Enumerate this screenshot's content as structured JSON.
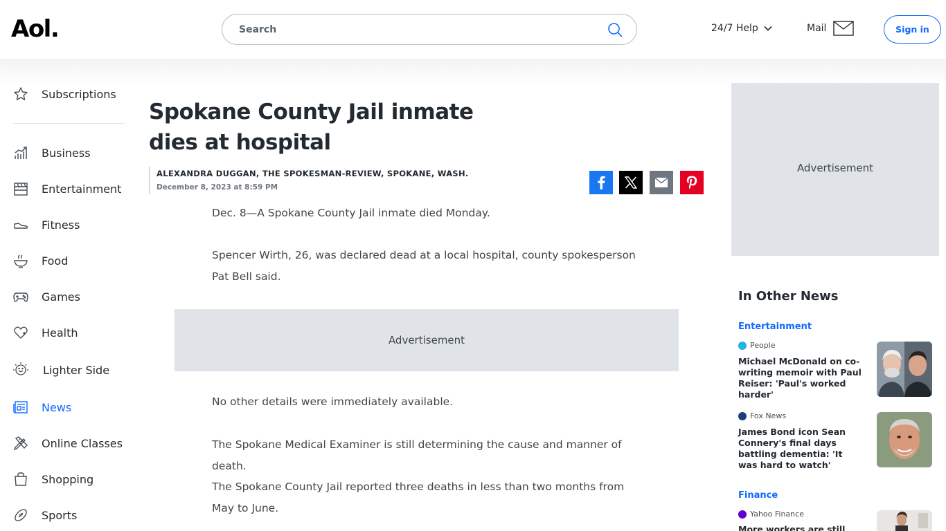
{
  "header": {
    "logo": "Aol.",
    "search_placeholder": "Search",
    "help_label": "24/7 Help",
    "mail_label": "Mail",
    "signin_label": "Sign in"
  },
  "sidebar": {
    "items": [
      {
        "label": "Subscriptions",
        "icon": "star-icon"
      },
      {
        "label": "Business",
        "icon": "chart-icon"
      },
      {
        "label": "Entertainment",
        "icon": "clapperboard-icon"
      },
      {
        "label": "Fitness",
        "icon": "shoe-icon"
      },
      {
        "label": "Food",
        "icon": "bowl-icon"
      },
      {
        "label": "Games",
        "icon": "gamepad-icon"
      },
      {
        "label": "Health",
        "icon": "heart-icon"
      },
      {
        "label": "Lighter Side",
        "icon": "smile-icon"
      },
      {
        "label": "News",
        "icon": "newspaper-icon",
        "active": true
      },
      {
        "label": "Online Classes",
        "icon": "pencil-ruler-icon"
      },
      {
        "label": "Shopping",
        "icon": "bag-icon"
      },
      {
        "label": "Sports",
        "icon": "football-icon"
      }
    ]
  },
  "article": {
    "title": "Spokane County Jail inmate dies at hospital",
    "author": "ALEXANDRA DUGGAN, THE SPOKESMAN-REVIEW, SPOKANE, WASH.",
    "date": "December 8, 2023 at 8:59 PM",
    "paragraphs": [
      "Dec. 8—A Spokane County Jail inmate died Monday.",
      "Spencer Wirth, 26, was declared dead at a local hospital, county spokesperson Pat Bell said.",
      "No other details were immediately available.",
      "The Spokane Medical Examiner is still determining the cause and manner of death.",
      "The Spokane County Jail reported three deaths in less than two months from May to June."
    ],
    "ad_label": "Advertisement"
  },
  "share": {
    "facebook": "facebook-icon",
    "x": "x-icon",
    "email": "email-icon",
    "pinterest": "pinterest-icon"
  },
  "right_rail": {
    "ad_label": "Advertisement",
    "section_title": "In Other News",
    "groups": [
      {
        "category": "Entertainment",
        "stories": [
          {
            "source": "People",
            "headline": "Michael McDonald on co-writing memoir with Paul Reiser: 'Paul's worked harder'"
          },
          {
            "source": "Fox News",
            "headline": "James Bond icon Sean Connery's final days battling dementia: 'It was hard to watch'"
          }
        ]
      },
      {
        "category": "Finance",
        "stories": [
          {
            "source": "Yahoo Finance",
            "headline": "More workers are still"
          }
        ]
      }
    ]
  },
  "colors": {
    "accent": "#0f69ff",
    "facebook": "#1a77f2",
    "pinterest": "#e60023",
    "ad_bg": "#e0e4e9"
  }
}
